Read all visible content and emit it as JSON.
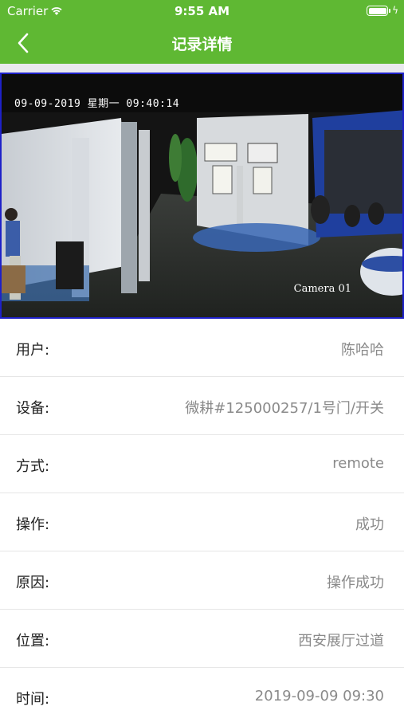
{
  "status_bar": {
    "carrier": "Carrier",
    "time": "9:55 AM",
    "wifi_icon": "wifi-icon",
    "battery_icon": "battery-full-icon",
    "charging_icon": "charging-bolt-icon"
  },
  "nav": {
    "title": "记录详情",
    "back_icon": "chevron-left-icon",
    "bg_color": "#5fb833"
  },
  "video": {
    "timestamp": "09-09-2019 星期一 09:40:14",
    "camera_label": "Camera 01",
    "border_color": "#1e21c8"
  },
  "details": [
    {
      "label": "用户:",
      "value": "陈哈哈"
    },
    {
      "label": "设备:",
      "value": "微耕#125000257/1号门/开关"
    },
    {
      "label": "方式:",
      "value": "remote"
    },
    {
      "label": "操作:",
      "value": "成功"
    },
    {
      "label": "原因:",
      "value": "操作成功"
    },
    {
      "label": "位置:",
      "value": "西安展厅过道"
    },
    {
      "label": "时间:",
      "value": "2019-09-09 09:30"
    }
  ]
}
